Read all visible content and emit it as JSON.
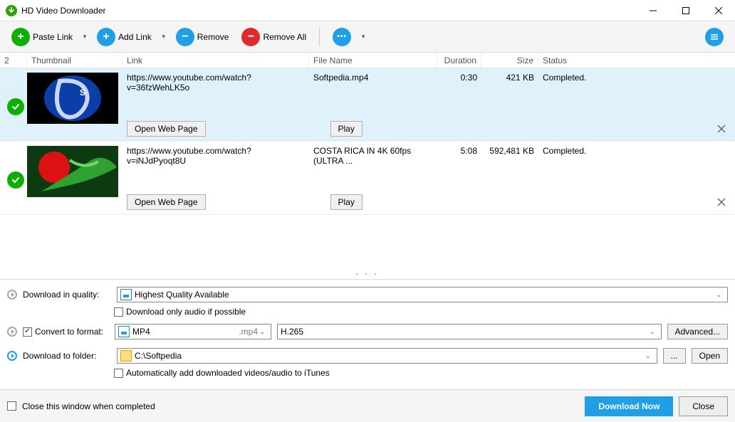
{
  "window": {
    "title": "HD Video Downloader"
  },
  "toolbar": {
    "paste_link": "Paste Link",
    "add_link": "Add Link",
    "remove": "Remove",
    "remove_all": "Remove All"
  },
  "columns": {
    "count": "2",
    "thumbnail": "Thumbnail",
    "link": "Link",
    "file_name": "File Name",
    "duration": "Duration",
    "size": "Size",
    "status": "Status"
  },
  "rows": [
    {
      "link": "https://www.youtube.com/watch?v=36fzWehLK5o",
      "file_name": "Softpedia.mp4",
      "duration": "0:30",
      "size": "421 KB",
      "status": "Completed.",
      "open_web": "Open Web Page",
      "play": "Play"
    },
    {
      "link": "https://www.youtube.com/watch?v=iNJdPyoqt8U",
      "file_name": "COSTA RICA IN 4K 60fps (ULTRA ...",
      "duration": "5:08",
      "size": "592,481 KB",
      "status": "Completed.",
      "open_web": "Open Web Page",
      "play": "Play"
    }
  ],
  "settings": {
    "quality_label": "Download in quality:",
    "quality_value": "Highest Quality Available",
    "audio_only": "Download only audio if possible",
    "convert_label": "Convert to format:",
    "convert_value": "MP4",
    "convert_ext": ".mp4",
    "codec_value": "H.265",
    "advanced": "Advanced...",
    "folder_label": "Download to folder:",
    "folder_value": "C:\\Softpedia",
    "browse": "...",
    "open": "Open",
    "auto_itunes": "Automatically add downloaded videos/audio to iTunes"
  },
  "footer": {
    "close_when_done": "Close this window when completed",
    "download_now": "Download Now",
    "close": "Close"
  }
}
